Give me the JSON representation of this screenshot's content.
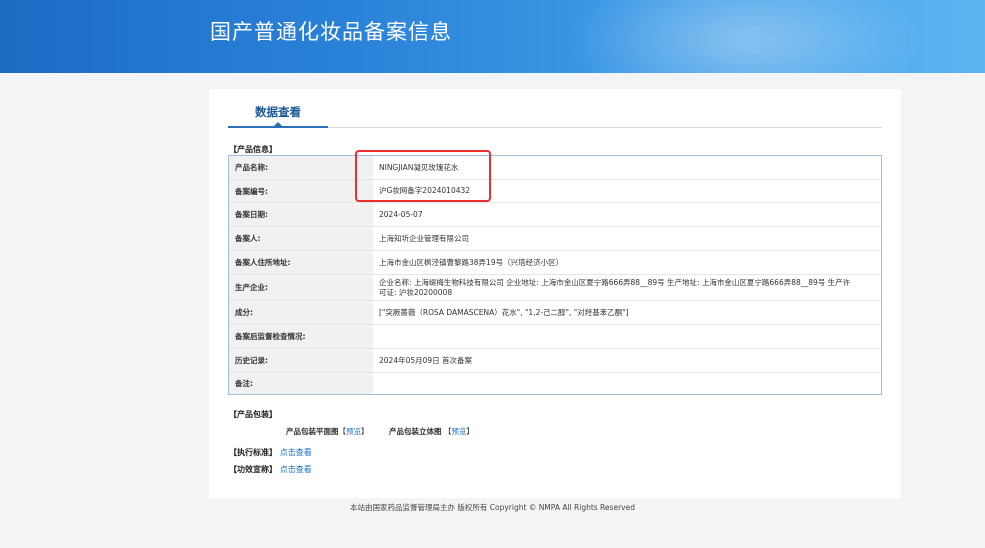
{
  "header": {
    "title": "国产普通化妆品备案信息"
  },
  "tab": {
    "label": "数据查看"
  },
  "sections": {
    "product_info": "【产品信息】",
    "product_package": "【产品包装】",
    "exec_standard": "【执行标准】",
    "efficacy_claim": "【功效宣称】"
  },
  "info_rows": [
    {
      "label": "产品名称:",
      "value": "NINGJIAN凝见玫瑰花水"
    },
    {
      "label": "备案编号:",
      "value": "沪G妆网备字2024010432"
    },
    {
      "label": "备案日期:",
      "value": "2024-05-07"
    },
    {
      "label": "备案人:",
      "value": "上海知圻企业管理有限公司"
    },
    {
      "label": "备案人住所地址:",
      "value": "上海市金山区枫泾镇曹黎路38弄19号（兴塔经济小区）"
    },
    {
      "label": "生产企业:",
      "value": "企业名称: 上海缇梅生物科技有限公司 企业地址: 上海市金山区夏宁路666弄88__89号 生产地址: 上海市金山区夏宁路666弄88__89号 生产许可证: 沪妆20200008"
    },
    {
      "label": "成分:",
      "value": "[\"突厥蔷薇（ROSA DAMASCENA）花水\", \"1,2-己二醇\", \"对羟基苯乙酮\"]"
    },
    {
      "label": "备案后监督检查情况:",
      "value": ""
    },
    {
      "label": "历史记录:",
      "value": "2024年05月09日 首次备案"
    },
    {
      "label": "备注:",
      "value": ""
    }
  ],
  "package": {
    "flat_label": "产品包装平面图",
    "three_d_label": "产品包装立体图",
    "preview_bracket_open": "【",
    "preview_link": "预览",
    "preview_bracket_close": "】"
  },
  "links": {
    "exec_standard_link": "点击查看",
    "efficacy_link": "点击查看"
  },
  "footer": {
    "text": "本站由国家药品监督管理局主办 版权所有 Copyright © NMPA All Rights Reserved"
  },
  "colors": {
    "banner": "#2a82d8",
    "accent": "#2b6fb8",
    "highlight": "#e8302f"
  }
}
